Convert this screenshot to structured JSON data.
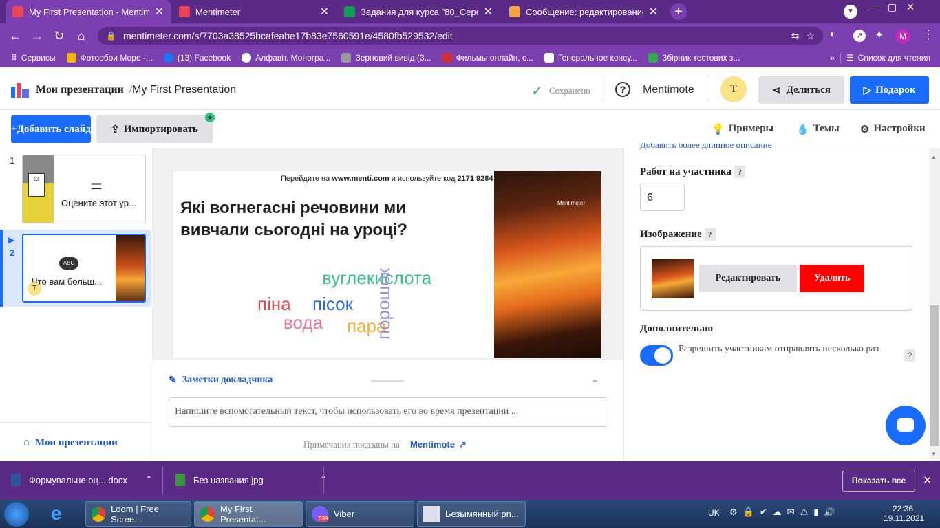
{
  "browser": {
    "tabs": [
      {
        "title": "My First Presentation - Mentimet",
        "color": "#e8445a",
        "active": true
      },
      {
        "title": "Mentimeter",
        "color": "#e8445a",
        "active": false
      },
      {
        "title": "Задания для курса \"80_Середні",
        "color": "#0f9d58",
        "active": false
      },
      {
        "title": "Сообщение: редактирование",
        "color": "#f4a142",
        "active": false
      }
    ],
    "url": "mentimeter.com/s/7703a38525bcafeabe17b83e7560591e/4580fb529532/edit",
    "profile_letter": "M",
    "bookmarks": [
      "Сервисы",
      "Фотообои Море -...",
      "(13) Facebook",
      "Алфавіт. Моногра...",
      "Зерновий вивід (3...",
      "Фильмы онлайн, с...",
      "Генеральное консу...",
      "Збірник тестових з..."
    ],
    "reading_list": "Список для чтения",
    "overflow": "»"
  },
  "app": {
    "breadcrumb_root": "Мои презентации",
    "breadcrumb_sep": "/",
    "presentation_title": "My First Presentation",
    "saved_label": "Сохранено",
    "mentimote_label": "Mentimote",
    "avatar_letter": "T",
    "share_label": "Делиться",
    "present_label": "Подарок",
    "add_slide_label": "Добавить слайд",
    "import_label": "Импортировать",
    "examples_label": "Примеры",
    "themes_label": "Темы",
    "settings_label": "Настройки"
  },
  "slides": [
    {
      "number": "1",
      "label": "Оцените этот ур..."
    },
    {
      "number": "2",
      "label": "Что вам больш...",
      "icon_text": "ABC",
      "avatar": "T"
    }
  ],
  "my_presentations_link": "Мои презентации",
  "slide": {
    "join_prefix": "Перейдите на",
    "join_site": "www.menti.com",
    "join_middle": "и используйте код",
    "join_code": "2171 9284",
    "question": "Які вогнегасні речовини ми вивчали сьогодні на уроці?",
    "brand": "Mentimeter",
    "words": [
      {
        "text": "вуглекислота",
        "color": "#3cc08a"
      },
      {
        "text": "піна",
        "color": "#e0474c"
      },
      {
        "text": "пісок",
        "color": "#2f6bd6"
      },
      {
        "text": "вода",
        "color": "#e27a9b"
      },
      {
        "text": "пара",
        "color": "#f2b33a"
      },
      {
        "text": "порошок",
        "color": "#9a8fe0"
      }
    ]
  },
  "notes": {
    "title": "Заметки докладчика",
    "placeholder": "Напишите вспомогательный текст, чтобы использовать его во время презентации ...",
    "footer_prefix": "Примечания показаны на",
    "footer_link": "Mentimote"
  },
  "settings_panel": {
    "cut_link": "Добавить более длинное описание",
    "entries_label": "Работ на участника",
    "entries_value": "6",
    "image_label": "Изображение",
    "edit_label": "Редактировать",
    "delete_label": "Удалять",
    "advanced_label": "Дополнительно",
    "multi_submit_label": "Разрешить участникам отправлять несколько раз",
    "help": "?",
    "multi_submit_enabled": true
  },
  "downloads": {
    "items": [
      "Формувальне оц....docx",
      "Без названия.jpg"
    ],
    "show_all": "Показать все"
  },
  "taskbar": {
    "items": [
      "Loom | Free Scree...",
      "My First Presentat...",
      "Viber",
      "Безымянный.pn..."
    ],
    "viber_badge": "539",
    "lang": "UK",
    "time": "22:36",
    "date": "19.11.2021"
  }
}
